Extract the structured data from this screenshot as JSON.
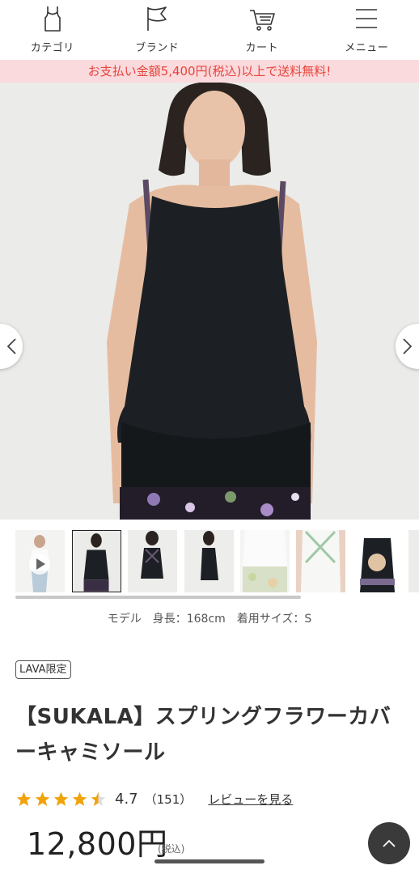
{
  "nav": {
    "items": [
      {
        "label": "カテゴリ",
        "icon": "tank-top-icon"
      },
      {
        "label": "ブランド",
        "icon": "flag-icon"
      },
      {
        "label": "カート",
        "icon": "cart-icon"
      },
      {
        "label": "メニュー",
        "icon": "hamburger-menu-icon"
      }
    ]
  },
  "promo": {
    "text": "お支払い金額5,400円(税込)以上で送料無料!"
  },
  "gallery": {
    "thumbnail_count": 9,
    "selected_index": 1,
    "scroll_position": 0.0
  },
  "model_info": "モデル　身長：168cm　着用サイズ：S",
  "product": {
    "badge": "LAVA限定",
    "title": "【SUKALA】スプリングフラワーカバーキャミソール",
    "rating": {
      "stars": 4.7,
      "value": "4.7",
      "count": "（151）",
      "review_link": "レビューを見る"
    },
    "price": "12,800円",
    "tax_note": "(税込)"
  },
  "colors": {
    "promo_bg": "#fadadd",
    "promo_text": "#e8443a",
    "star": "#f0a30a",
    "to_top_bg": "#3a3a3a"
  }
}
